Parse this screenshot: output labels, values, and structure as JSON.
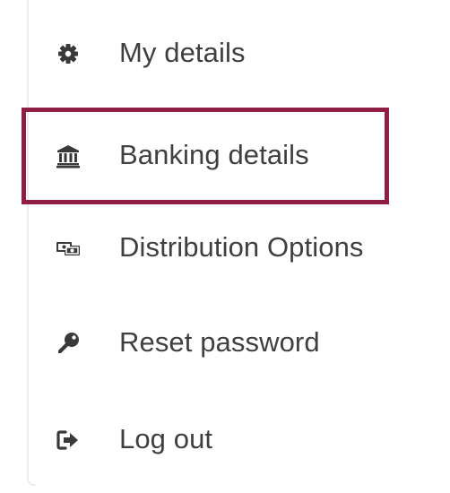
{
  "menu": {
    "items": [
      {
        "label": "My details",
        "icon": "gear-icon",
        "selected": false
      },
      {
        "label": "Banking details",
        "icon": "bank-icon",
        "selected": true
      },
      {
        "label": "Distribution Options",
        "icon": "money-icon",
        "selected": false
      },
      {
        "label": "Reset password",
        "icon": "key-icon",
        "selected": false
      },
      {
        "label": "Log out",
        "icon": "sign-out-icon",
        "selected": false
      }
    ]
  },
  "colors": {
    "highlight_border": "#8f1d44",
    "label_text": "#3f3f3f",
    "icon": "#3a3a3a",
    "panel_edge": "#ececec"
  }
}
